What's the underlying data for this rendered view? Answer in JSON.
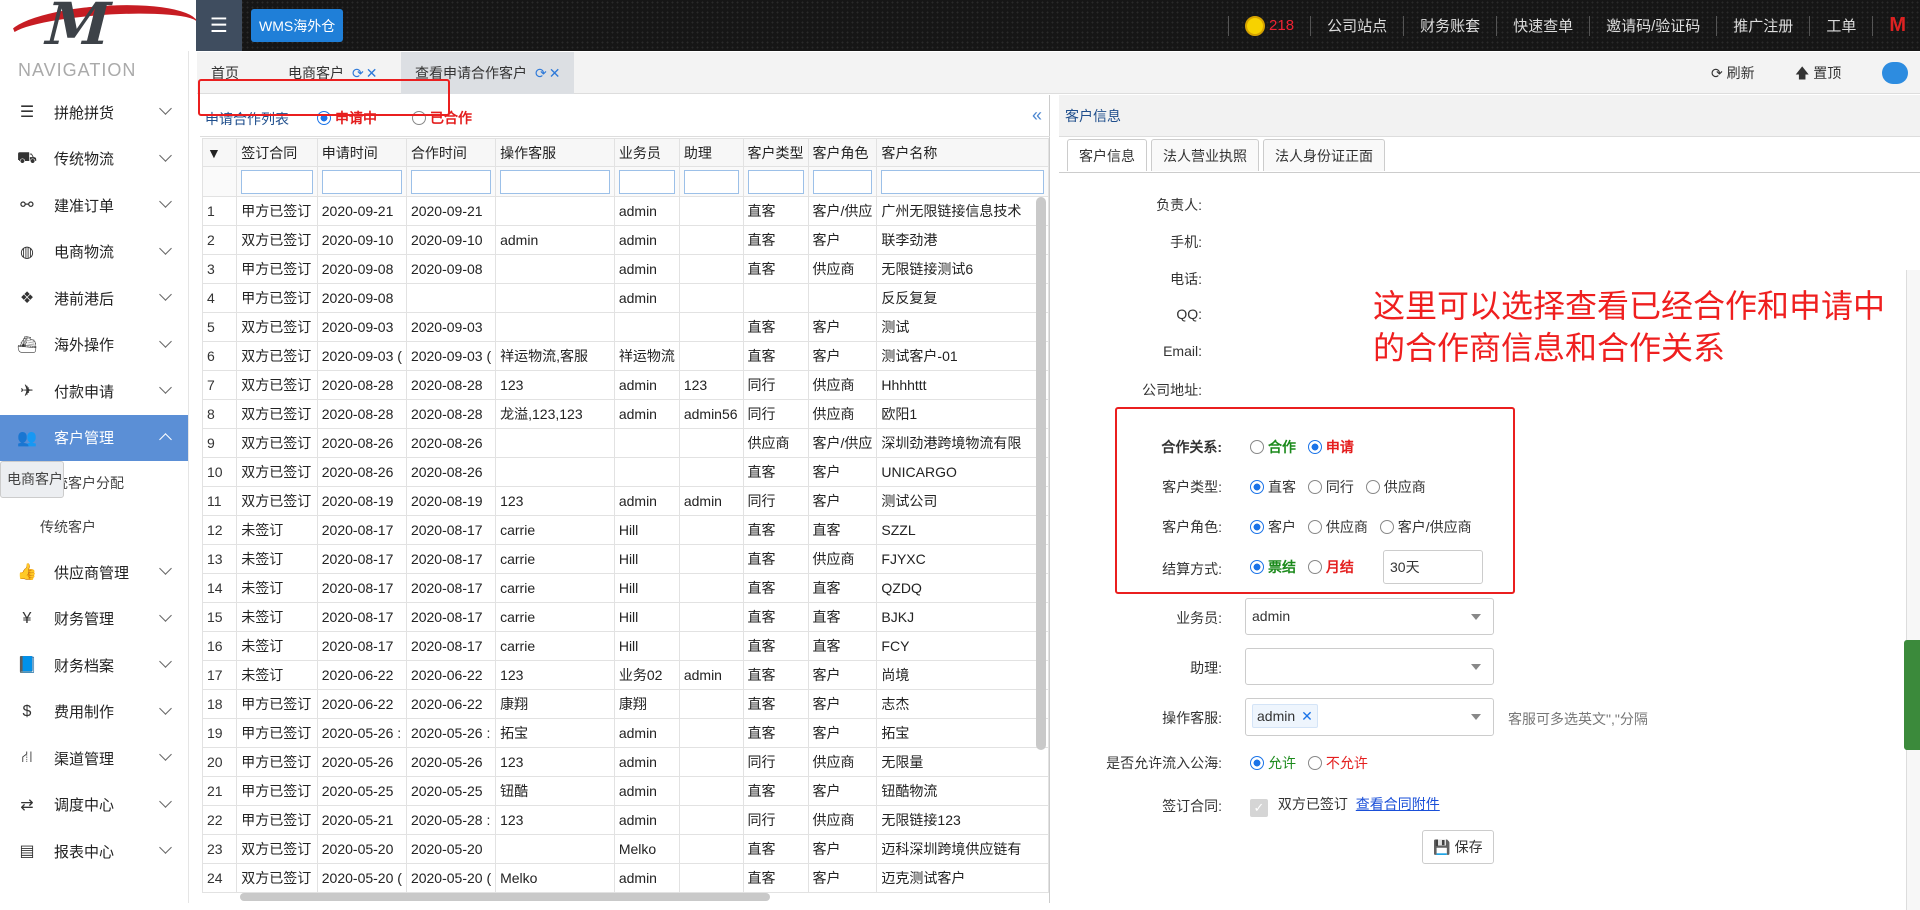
{
  "topbar": {
    "brand": "WMS海外仓",
    "coin_count": "218",
    "links": [
      "公司站点",
      "财务账套",
      "快速查单",
      "邀请码/验证码",
      "推广注册",
      "工单"
    ]
  },
  "sidebar": {
    "title": "NAVIGATION",
    "items": [
      {
        "label": "拼舱拼货",
        "icon": "list-icon"
      },
      {
        "label": "传统物流",
        "icon": "truck-icon"
      },
      {
        "label": "建准订单",
        "icon": "link-icon"
      },
      {
        "label": "电商物流",
        "icon": "globe-icon"
      },
      {
        "label": "港前港后",
        "icon": "boxes-icon"
      },
      {
        "label": "海外操作",
        "icon": "ship-icon"
      },
      {
        "label": "付款申请",
        "icon": "plane-icon"
      },
      {
        "label": "客户管理",
        "icon": "users-icon",
        "active": true
      }
    ],
    "sub_items": [
      "电商客户",
      "传统客户分配",
      "传统客户"
    ],
    "items_after": [
      {
        "label": "供应商管理",
        "icon": "thumbs-up-icon"
      },
      {
        "label": "财务管理",
        "icon": "yen-icon"
      },
      {
        "label": "财务档案",
        "icon": "book-icon"
      },
      {
        "label": "费用制作",
        "icon": "dollar-icon"
      },
      {
        "label": "渠道管理",
        "icon": "road-icon"
      },
      {
        "label": "调度中心",
        "icon": "retweet-icon"
      },
      {
        "label": "报表中心",
        "icon": "chart-icon"
      }
    ]
  },
  "tabs": {
    "home": "首页",
    "ecommerce": "电商客户",
    "apply": "查看申请合作客户",
    "refresh": "刷新",
    "top": "置顶"
  },
  "list": {
    "title": "申请合作列表",
    "radio_applying": "申请中",
    "radio_cooperated": "已合作",
    "columns": [
      "签订合同",
      "申请时间",
      "合作时间",
      "操作客服",
      "业务员",
      "助理",
      "客户类型",
      "客户角色",
      "客户名称"
    ],
    "rows": [
      [
        "1",
        "甲方已签订",
        "2020-09-21",
        "2020-09-21",
        "",
        "admin",
        "",
        "直客",
        "客户/供应",
        "广州无限链接信息技术"
      ],
      [
        "2",
        "双方已签订",
        "2020-09-10",
        "2020-09-10",
        "admin",
        "admin",
        "",
        "直客",
        "客户",
        "联李劲港"
      ],
      [
        "3",
        "甲方已签订",
        "2020-09-08",
        "2020-09-08",
        "",
        "admin",
        "",
        "直客",
        "供应商",
        "无限链接测试6"
      ],
      [
        "4",
        "甲方已签订",
        "2020-09-08",
        "",
        "",
        "admin",
        "",
        "",
        "",
        "反反复复"
      ],
      [
        "5",
        "双方已签订",
        "2020-09-03",
        "2020-09-03",
        "",
        "",
        "",
        "直客",
        "客户",
        "测试"
      ],
      [
        "6",
        "双方已签订",
        "2020-09-03 (",
        "2020-09-03 (",
        "祥运物流,客服",
        "祥运物流",
        "",
        "直客",
        "客户",
        "测试客户-01"
      ],
      [
        "7",
        "双方已签订",
        "2020-08-28",
        "2020-08-28",
        "123",
        "admin",
        "123",
        "同行",
        "供应商",
        "Hhhhttt"
      ],
      [
        "8",
        "双方已签订",
        "2020-08-28",
        "2020-08-28",
        "龙溢,123,123",
        "admin",
        "admin56",
        "同行",
        "供应商",
        "欧阳1"
      ],
      [
        "9",
        "双方已签订",
        "2020-08-26",
        "2020-08-26",
        "",
        "",
        "",
        "供应商",
        "客户/供应",
        "深圳劲港跨境物流有限"
      ],
      [
        "10",
        "双方已签订",
        "2020-08-26",
        "2020-08-26",
        "",
        "",
        "",
        "直客",
        "客户",
        "UNICARGO"
      ],
      [
        "11",
        "双方已签订",
        "2020-08-19",
        "2020-08-19",
        "123",
        "admin",
        "admin",
        "同行",
        "客户",
        "测试公司"
      ],
      [
        "12",
        "未签订",
        "2020-08-17",
        "2020-08-17",
        "carrie",
        "Hill",
        "",
        "直客",
        "直客",
        "SZZL"
      ],
      [
        "13",
        "未签订",
        "2020-08-17",
        "2020-08-17",
        "carrie",
        "Hill",
        "",
        "直客",
        "供应商",
        "FJYXC"
      ],
      [
        "14",
        "未签订",
        "2020-08-17",
        "2020-08-17",
        "carrie",
        "Hill",
        "",
        "直客",
        "直客",
        "QZDQ"
      ],
      [
        "15",
        "未签订",
        "2020-08-17",
        "2020-08-17",
        "carrie",
        "Hill",
        "",
        "直客",
        "直客",
        "BJKJ"
      ],
      [
        "16",
        "未签订",
        "2020-08-17",
        "2020-08-17",
        "carrie",
        "Hill",
        "",
        "直客",
        "直客",
        "FCY"
      ],
      [
        "17",
        "未签订",
        "2020-06-22",
        "2020-06-22",
        "123",
        "业务02",
        "admin",
        "直客",
        "客户",
        "尚境"
      ],
      [
        "18",
        "甲方已签订",
        "2020-06-22",
        "2020-06-22",
        "康翔",
        "康翔",
        "",
        "直客",
        "客户",
        "志杰"
      ],
      [
        "19",
        "甲方已签订",
        "2020-05-26 :",
        "2020-05-26 :",
        "拓宝",
        "admin",
        "",
        "直客",
        "客户",
        "拓宝"
      ],
      [
        "20",
        "甲方已签订",
        "2020-05-26",
        "2020-05-26",
        "123",
        "admin",
        "",
        "同行",
        "供应商",
        "无限量"
      ],
      [
        "21",
        "甲方已签订",
        "2020-05-25",
        "2020-05-25",
        "钮酷",
        "admin",
        "",
        "直客",
        "客户",
        "钮酷物流"
      ],
      [
        "22",
        "甲方已签订",
        "2020-05-21",
        "2020-05-28 :",
        "123",
        "admin",
        "",
        "同行",
        "供应商",
        "无限链接123"
      ],
      [
        "23",
        "双方已签订",
        "2020-05-20",
        "2020-05-20",
        "",
        "Melko",
        "",
        "直客",
        "客户",
        "迈科深圳跨境供应链有"
      ],
      [
        "24",
        "双方已签订",
        "2020-05-20 (",
        "2020-05-20 (",
        "Melko",
        "admin",
        "",
        "直客",
        "客户",
        "迈克测试客户"
      ]
    ]
  },
  "detail": {
    "title": "客户信息",
    "tabs": [
      "客户信息",
      "法人营业执照",
      "法人身份证正面"
    ],
    "labels": {
      "owner": "负责人:",
      "mobile": "手机:",
      "phone": "电话:",
      "qq": "QQ:",
      "email": "Email:",
      "address": "公司地址:",
      "relation": "合作关系:",
      "cust_type": "客户类型:",
      "cust_role": "客户角色:",
      "settle": "结算方式:",
      "salesman": "业务员:",
      "assistant": "助理:",
      "service": "操作客服:",
      "public_pool": "是否允许流入公海:",
      "contract": "签订合同:"
    },
    "relation_opts": [
      "合作",
      "申请"
    ],
    "type_opts": [
      "直客",
      "同行",
      "供应商"
    ],
    "role_opts": [
      "客户",
      "供应商",
      "客户/供应商"
    ],
    "settle_opts": [
      "票结",
      "月结"
    ],
    "settle_days": "30天",
    "salesman_value": "admin",
    "service_chip": "admin",
    "service_hint": "客服可多选英文\",\"分隔",
    "pool_opts": [
      "允许",
      "不允许"
    ],
    "contract_text": "双方已签订",
    "contract_link": "查看合同附件",
    "save": "保存"
  },
  "annotation": [
    "这里可以选择查看已经合作和申请中",
    "的合作商信息和合作关系"
  ],
  "colors": {
    "accent": "#1f7fd8",
    "highlight_red": "#ea1f1f",
    "active_nav": "#5b8fd6"
  }
}
